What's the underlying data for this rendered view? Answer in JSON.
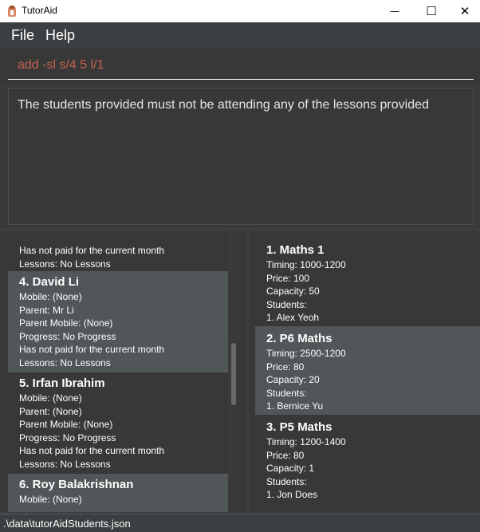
{
  "window": {
    "title": "TutorAid",
    "minimize_glyph": "—",
    "maximize_glyph": "☐",
    "close_glyph": "✕"
  },
  "menu": {
    "file": "File",
    "help": "Help"
  },
  "command": {
    "value": "add -sl s/4 5 l/1"
  },
  "result": {
    "text": "The students provided must not be attending any of the lessons provided"
  },
  "students": [
    {
      "lines": [
        "Has not paid for the current month",
        "Lessons: No Lessons"
      ]
    },
    {
      "title": "4.  David Li",
      "lines": [
        "Mobile: (None)",
        "Parent: Mr Li",
        "Parent Mobile: (None)",
        "Progress: No Progress",
        "Has not paid for the current month",
        "Lessons: No Lessons"
      ]
    },
    {
      "title": "5.  Irfan Ibrahim",
      "lines": [
        "Mobile: (None)",
        "Parent: (None)",
        "Parent Mobile: (None)",
        "Progress: No Progress",
        "Has not paid for the current month",
        "Lessons: No Lessons"
      ]
    },
    {
      "title": "6.  Roy Balakrishnan",
      "lines": [
        "Mobile: (None)"
      ]
    }
  ],
  "lessons": [
    {
      "title": "1.  Maths 1",
      "lines": [
        "Timing: 1000-1200",
        "Price: 100",
        "Capacity: 50",
        "Students:",
        "1.  Alex Yeoh"
      ]
    },
    {
      "title": "2.  P6 Maths",
      "lines": [
        "Timing: 2500-1200",
        "Price: 80",
        "Capacity: 20",
        "Students:",
        "1.  Bernice Yu"
      ]
    },
    {
      "title": "3.  P5 Maths",
      "lines": [
        "Timing: 1200-1400",
        "Price: 80",
        "Capacity: 1",
        "Students:",
        "1.  Jon Does"
      ]
    }
  ],
  "status": {
    "path": ".\\data\\tutorAidStudents.json"
  },
  "colors": {
    "background": "#3c3f41",
    "command_text": "#c8614f",
    "card_highlight": "#515658",
    "card_dark": "#383838"
  }
}
